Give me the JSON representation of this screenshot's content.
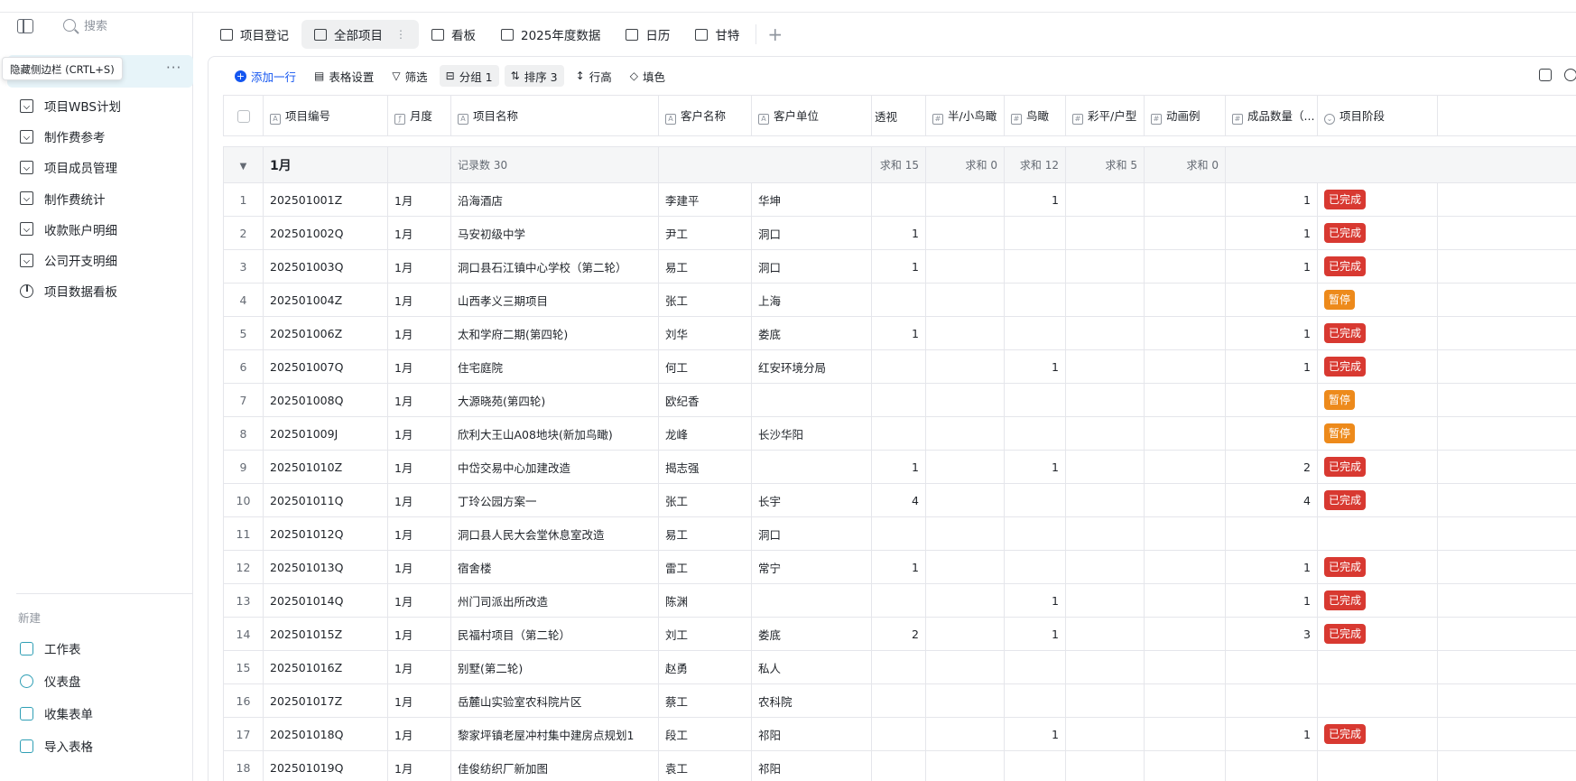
{
  "sidebar": {
    "search_label": "搜索",
    "tooltip": "隐藏侧边栏 (CRTL+S)",
    "items": [
      {
        "label": "项目WBS计划",
        "icon": "sheet-icon"
      },
      {
        "label": "制作费参考",
        "icon": "sheet-icon"
      },
      {
        "label": "项目成员管理",
        "icon": "sheet-icon"
      },
      {
        "label": "制作费统计",
        "icon": "sheet-icon"
      },
      {
        "label": "收款账户明细",
        "icon": "sheet-icon"
      },
      {
        "label": "公司开支明细",
        "icon": "sheet-icon"
      },
      {
        "label": "项目数据看板",
        "icon": "dashboard-icon"
      }
    ],
    "new_label": "新建",
    "new_items": [
      {
        "label": "工作表"
      },
      {
        "label": "仪表盘"
      },
      {
        "label": "收集表单"
      },
      {
        "label": "导入表格"
      }
    ]
  },
  "tabs": [
    {
      "label": "项目登记"
    },
    {
      "label": "全部项目"
    },
    {
      "label": "看板"
    },
    {
      "label": "2025年度数据"
    },
    {
      "label": "日历"
    },
    {
      "label": "甘特"
    }
  ],
  "toolbar": {
    "add_row": "添加一行",
    "table_settings": "表格设置",
    "filter": "筛选",
    "group": "分组 1",
    "sort": "排序 3",
    "row_height": "行高",
    "fill_color": "填色"
  },
  "columns": [
    "项目编号",
    "月度",
    "项目名称",
    "客户名称",
    "客户单位",
    "透视",
    "半/小鸟瞰",
    "鸟瞰",
    "彩平/户型",
    "动画例",
    "成品数量（...",
    "项目阶段"
  ],
  "group": {
    "name": "1月",
    "record_count": "记录数 30",
    "sum_toushi": "求和 15",
    "sum_banniaokan": "求和 0",
    "sum_niaokan": "求和 12",
    "sum_caiping": "求和 5",
    "sum_donghua": "求和 0"
  },
  "status_colors": {
    "已完成": "#d83931",
    "暂停": "#ed8a1b"
  },
  "rows": [
    {
      "idx": "1",
      "code": "202501001Z",
      "month": "1月",
      "name": "沿海酒店",
      "client": "李建平",
      "unit": "华坤",
      "toushi": "",
      "banniao": "",
      "niaokan": "1",
      "caiping": "",
      "donghua": "",
      "qty": "1",
      "stage": "已完成"
    },
    {
      "idx": "2",
      "code": "202501002Q",
      "month": "1月",
      "name": "马安初级中学",
      "client": "尹工",
      "unit": "洞口",
      "toushi": "1",
      "banniao": "",
      "niaokan": "",
      "caiping": "",
      "donghua": "",
      "qty": "1",
      "stage": "已完成"
    },
    {
      "idx": "3",
      "code": "202501003Q",
      "month": "1月",
      "name": "洞口县石江镇中心学校（第二轮）",
      "client": "易工",
      "unit": "洞口",
      "toushi": "1",
      "banniao": "",
      "niaokan": "",
      "caiping": "",
      "donghua": "",
      "qty": "1",
      "stage": "已完成"
    },
    {
      "idx": "4",
      "code": "202501004Z",
      "month": "1月",
      "name": "山西孝义三期项目",
      "client": "张工",
      "unit": "上海",
      "toushi": "",
      "banniao": "",
      "niaokan": "",
      "caiping": "",
      "donghua": "",
      "qty": "",
      "stage": "暂停"
    },
    {
      "idx": "5",
      "code": "202501006Z",
      "month": "1月",
      "name": "太和学府二期(第四轮)",
      "client": "刘华",
      "unit": "娄底",
      "toushi": "1",
      "banniao": "",
      "niaokan": "",
      "caiping": "",
      "donghua": "",
      "qty": "1",
      "stage": "已完成"
    },
    {
      "idx": "6",
      "code": "202501007Q",
      "month": "1月",
      "name": "住宅庭院",
      "client": "何工",
      "unit": "红安环境分局",
      "toushi": "",
      "banniao": "",
      "niaokan": "1",
      "caiping": "",
      "donghua": "",
      "qty": "1",
      "stage": "已完成"
    },
    {
      "idx": "7",
      "code": "202501008Q",
      "month": "1月",
      "name": "大源晓苑(第四轮)",
      "client": "欧纪香",
      "unit": "",
      "toushi": "",
      "banniao": "",
      "niaokan": "",
      "caiping": "",
      "donghua": "",
      "qty": "",
      "stage": "暂停"
    },
    {
      "idx": "8",
      "code": "202501009J",
      "month": "1月",
      "name": "欣利大王山A08地块(新加鸟瞰)",
      "client": "龙峰",
      "unit": "长沙华阳",
      "toushi": "",
      "banniao": "",
      "niaokan": "",
      "caiping": "",
      "donghua": "",
      "qty": "",
      "stage": "暂停"
    },
    {
      "idx": "9",
      "code": "202501010Z",
      "month": "1月",
      "name": "中岱交易中心加建改造",
      "client": "揭志强",
      "unit": "",
      "toushi": "1",
      "banniao": "",
      "niaokan": "1",
      "caiping": "",
      "donghua": "",
      "qty": "2",
      "stage": "已完成"
    },
    {
      "idx": "10",
      "code": "202501011Q",
      "month": "1月",
      "name": "丁玲公园方案一",
      "client": "张工",
      "unit": "长宇",
      "toushi": "4",
      "banniao": "",
      "niaokan": "",
      "caiping": "",
      "donghua": "",
      "qty": "4",
      "stage": "已完成"
    },
    {
      "idx": "11",
      "code": "202501012Q",
      "month": "1月",
      "name": "洞口县人民大会堂休息室改造",
      "client": "易工",
      "unit": "洞口",
      "toushi": "",
      "banniao": "",
      "niaokan": "",
      "caiping": "",
      "donghua": "",
      "qty": "",
      "stage": ""
    },
    {
      "idx": "12",
      "code": "202501013Q",
      "month": "1月",
      "name": "宿舍楼",
      "client": "雷工",
      "unit": "常宁",
      "toushi": "1",
      "banniao": "",
      "niaokan": "",
      "caiping": "",
      "donghua": "",
      "qty": "1",
      "stage": "已完成"
    },
    {
      "idx": "13",
      "code": "202501014Q",
      "month": "1月",
      "name": "州门司派出所改造",
      "client": "陈渊",
      "unit": "",
      "toushi": "",
      "banniao": "",
      "niaokan": "1",
      "caiping": "",
      "donghua": "",
      "qty": "1",
      "stage": "已完成"
    },
    {
      "idx": "14",
      "code": "202501015Z",
      "month": "1月",
      "name": "民福村项目（第二轮）",
      "client": "刘工",
      "unit": "娄底",
      "toushi": "2",
      "banniao": "",
      "niaokan": "1",
      "caiping": "",
      "donghua": "",
      "qty": "3",
      "stage": "已完成"
    },
    {
      "idx": "15",
      "code": "202501016Z",
      "month": "1月",
      "name": "别墅(第二轮)",
      "client": "赵勇",
      "unit": "私人",
      "toushi": "",
      "banniao": "",
      "niaokan": "",
      "caiping": "",
      "donghua": "",
      "qty": "",
      "stage": ""
    },
    {
      "idx": "16",
      "code": "202501017Z",
      "month": "1月",
      "name": "岳麓山实验室农科院片区",
      "client": "蔡工",
      "unit": "农科院",
      "toushi": "",
      "banniao": "",
      "niaokan": "",
      "caiping": "",
      "donghua": "",
      "qty": "",
      "stage": ""
    },
    {
      "idx": "17",
      "code": "202501018Q",
      "month": "1月",
      "name": "黎家坪镇老屋冲村集中建房点规划1",
      "client": "段工",
      "unit": "祁阳",
      "toushi": "",
      "banniao": "",
      "niaokan": "1",
      "caiping": "",
      "donghua": "",
      "qty": "1",
      "stage": "已完成"
    },
    {
      "idx": "18",
      "code": "202501019Q",
      "month": "1月",
      "name": "佳俊纺织厂新加图",
      "client": "袁工",
      "unit": "祁阳",
      "toushi": "",
      "banniao": "",
      "niaokan": "",
      "caiping": "",
      "donghua": "",
      "qty": "",
      "stage": ""
    }
  ]
}
